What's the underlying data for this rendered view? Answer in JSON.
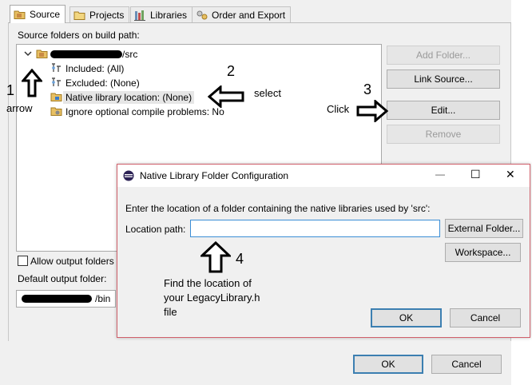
{
  "tabs": [
    {
      "label": "Source",
      "icon": "source-folder-icon",
      "active": true
    },
    {
      "label": "Projects",
      "icon": "projects-icon",
      "active": false
    },
    {
      "label": "Libraries",
      "icon": "libraries-icon",
      "active": false
    },
    {
      "label": "Order and Export",
      "icon": "order-export-icon",
      "active": false
    }
  ],
  "source_panel": {
    "heading": "Source folders on build path:",
    "tree": {
      "root_suffix": "/src",
      "children": [
        {
          "label": "Included: (All)"
        },
        {
          "label": "Excluded: (None)"
        },
        {
          "label": "Native library location: (None)",
          "selected": true
        },
        {
          "label": "Ignore optional compile problems: No"
        }
      ]
    },
    "buttons": {
      "add_folder": "Add Folder...",
      "link_source": "Link Source...",
      "edit": "Edit...",
      "remove": "Remove"
    },
    "allow_output_label": "Allow output folders",
    "default_output_label": "Default output folder:",
    "default_output_suffix": "/bin"
  },
  "dialog": {
    "title": "Native Library Folder Configuration",
    "prompt": "Enter the location of a folder containing the native libraries used by 'src':",
    "location_label": "Location path:",
    "location_value": "",
    "external_folder": "External Folder...",
    "workspace": "Workspace...",
    "ok": "OK",
    "cancel": "Cancel",
    "window_controls": {
      "minimize": "—",
      "maximize": "☐",
      "close": "✕"
    }
  },
  "main_buttons": {
    "ok": "OK",
    "cancel": "Cancel"
  },
  "annotations": {
    "n1": "1",
    "arrow_label": "arrow",
    "n2": "2",
    "select_label": "select",
    "n3": "3",
    "click_label": "Click",
    "n4": "4",
    "find_line1": "Find the location of",
    "find_line2": "your LegacyLibrary.h",
    "find_line3": "file"
  }
}
